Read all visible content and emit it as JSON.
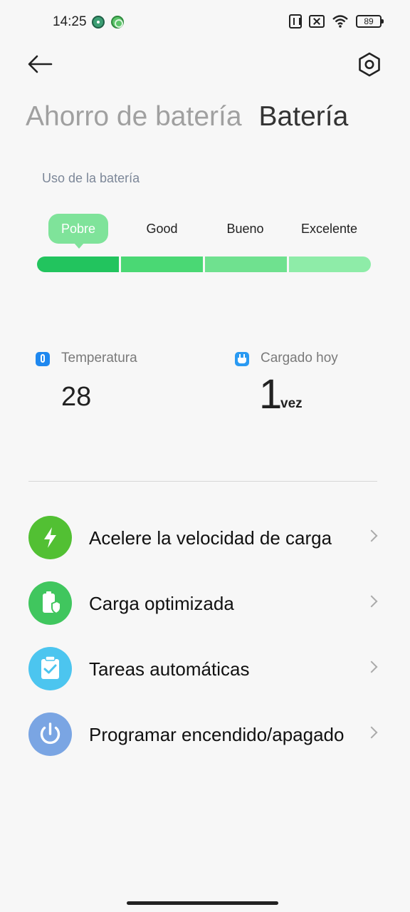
{
  "status_bar": {
    "time": "14:25",
    "battery_level": "89",
    "icons": [
      "notification-app-icon",
      "notification-app-icon-2",
      "nfc-icon",
      "no-sim-icon",
      "wifi-icon",
      "battery-icon"
    ]
  },
  "header": {
    "back_icon": "arrow-left-icon",
    "settings_icon": "settings-hex-icon"
  },
  "tabs": [
    {
      "label": "Ahorro de batería",
      "active": false
    },
    {
      "label": "Batería",
      "active": true
    }
  ],
  "usage": {
    "label": "Uso de la batería",
    "levels": [
      "Pobre",
      "Good",
      "Bueno",
      "Excelente"
    ],
    "selected_level": "Pobre",
    "bar_colors": [
      "#22c45e",
      "#4ad874",
      "#6fe18f",
      "#8eeca8"
    ]
  },
  "stats": {
    "temperature": {
      "label": "Temperatura",
      "value": "28",
      "icon": "thermometer-icon"
    },
    "charged_today": {
      "label": "Cargado hoy",
      "value": "1",
      "unit": "vez",
      "icon": "plug-icon"
    }
  },
  "menu": [
    {
      "label": "Acelere la velocidad de carga",
      "icon": "bolt-icon",
      "color": "#52c033"
    },
    {
      "label": "Carga optimizada",
      "icon": "battery-shield-icon",
      "color": "#40c65e"
    },
    {
      "label": "Tareas automáticas",
      "icon": "clipboard-check-icon",
      "color": "#4cc5ef"
    },
    {
      "label": "Programar encendido/apagado",
      "icon": "power-icon",
      "color": "#7aa5e3"
    }
  ]
}
